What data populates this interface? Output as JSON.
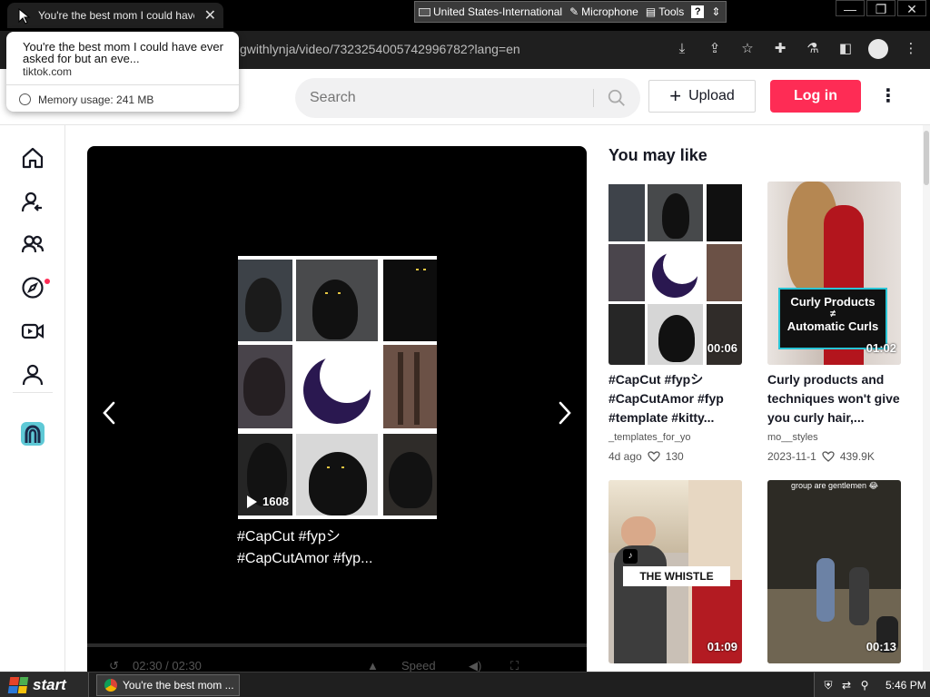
{
  "browser": {
    "tab_title": "You're the best mom I could have ever asked for but an eve...",
    "tab_title_short": "You're the best mom I could have e",
    "url": "gwithlynja/video/7323254005742996782?lang=en",
    "language_bar": {
      "language": "United States-International",
      "microphone": "Microphone",
      "tools": "Tools",
      "help": "?"
    },
    "popup": {
      "title": "You're the best mom I could have ever asked for but an eve...",
      "domain": "tiktok.com",
      "memory": "Memory usage: 241 MB"
    }
  },
  "header": {
    "search_placeholder": "Search",
    "upload_label": "Upload",
    "login_label": "Log in"
  },
  "player": {
    "play_count": "1608",
    "caption_line1": "#CapCut #fypシ",
    "caption_line2": "#CapCutAmor #fyp...",
    "time": "02:30 / 02:30",
    "speed": "Speed"
  },
  "recommendations": {
    "title": "You may like",
    "cards": [
      {
        "duration": "00:06",
        "description": "#CapCut #fypシ #CapCutAmor #fyp #template #kitty...",
        "author": "_templates_for_yo",
        "date": "4d ago",
        "likes": "130"
      },
      {
        "duration": "01:02",
        "description": "Curly products and techniques won't give you curly hair,...",
        "author": "mo__styles",
        "date": "2023-11-1",
        "likes": "439.9K",
        "overlay_line1": "Curly Products",
        "overlay_line2": "≠",
        "overlay_line3": "Automatic Curls"
      },
      {
        "duration": "01:09",
        "overlay": "THE WHISTLE"
      },
      {
        "duration": "00:13",
        "overlay": "group are gentlemen 😂"
      }
    ]
  },
  "taskbar": {
    "start": "start",
    "task": "You're the best mom ...",
    "clock": "5:46 PM"
  },
  "colors": {
    "brand": "#fe2c55",
    "moon": "#2a1850"
  }
}
